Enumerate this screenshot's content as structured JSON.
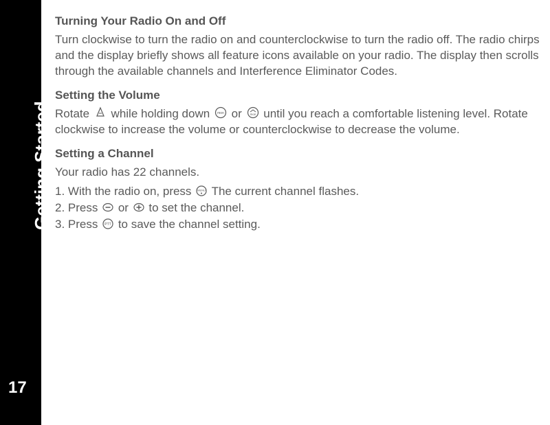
{
  "sidebar": {
    "page_number": "17",
    "section": "Getting Started"
  },
  "section1": {
    "heading": "Turning Your Radio On and Off",
    "pre": "Turn ",
    "post": " clockwise to turn the radio on and counterclockwise to turn the radio off. The radio chirps and the display briefly shows all feature icons available on your radio. The display then scrolls through the available channels and Interference Eliminator Codes."
  },
  "section2": {
    "heading": "Setting the Volume",
    "t1": "Rotate ",
    "t2": " while holding down ",
    "t3": "or ",
    "t4": " until you reach a comfortable listening level. Rotate clockwise to increase the volume or counterclockwise to decrease the volume."
  },
  "section3": {
    "heading": "Setting a Channel",
    "intro": "Your radio has 22 channels.",
    "step1_a": "1. With the radio on, press ",
    "step1_b": " The current channel flashes.",
    "step2_a": "2. Press ",
    "step2_b": " or ",
    "step2_c": " to set the channel.",
    "step3_a": "3. Press",
    "step3_b": "to save the channel setting."
  }
}
